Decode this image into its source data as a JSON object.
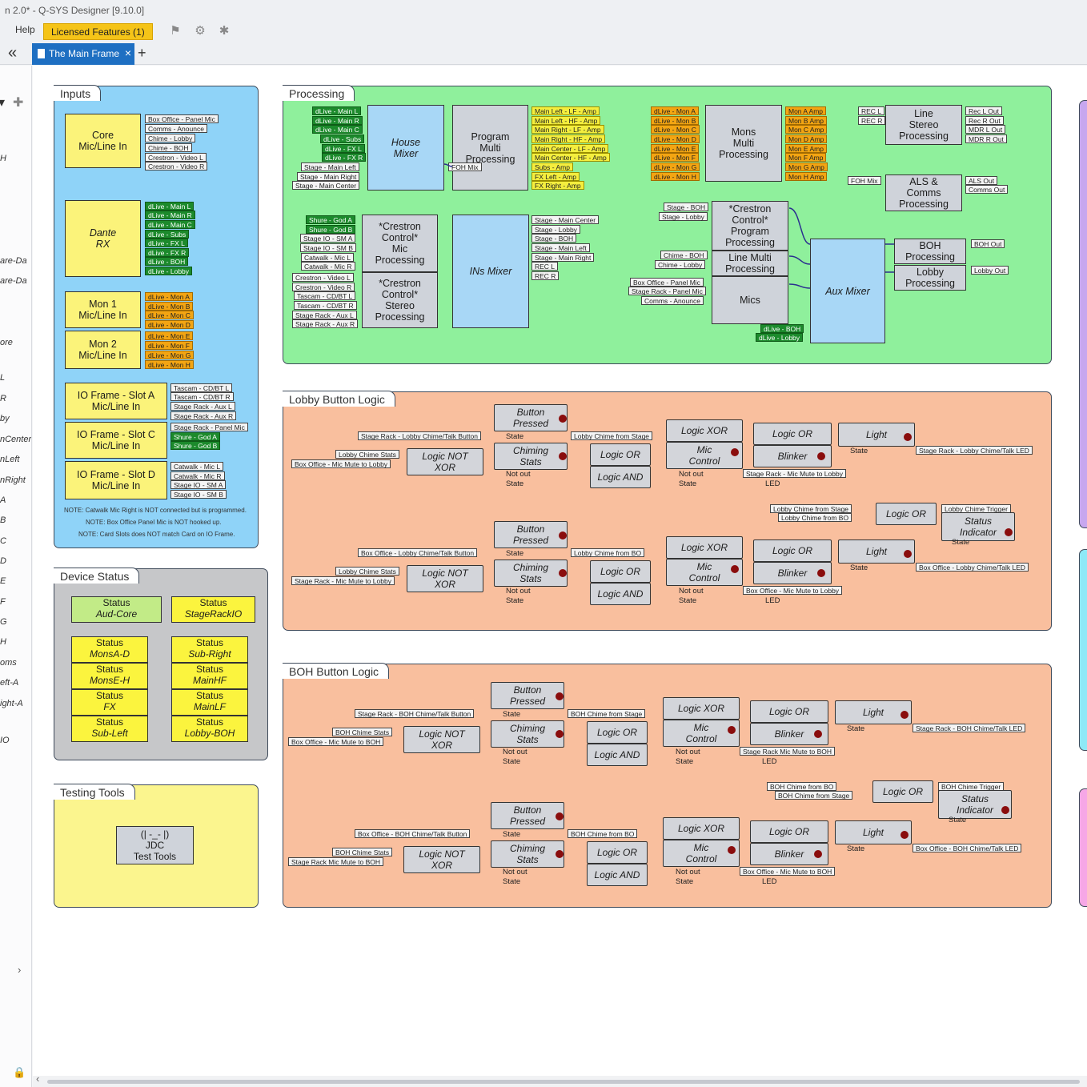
{
  "window": {
    "title": "n 2.0* - Q-SYS Designer [9.10.0]"
  },
  "menu": {
    "help": "Help",
    "licensed": "Licensed Features (1)"
  },
  "toolbar": {
    "icons": [
      "megaphone-icon",
      "gear-refresh-icon",
      "puzzle-icon"
    ]
  },
  "tabs": {
    "active": "The Main Frame",
    "add": "+"
  },
  "left_strip": {
    "items": [
      "are-Da",
      "are-Da",
      "ore",
      "L",
      "R",
      "by",
      "nCenter",
      "nLeft",
      "nRight",
      "A",
      "B",
      "C",
      "D",
      "E",
      "F",
      "G",
      "H",
      "oms",
      "eft-A",
      "ight-A",
      "IO"
    ]
  },
  "groups": {
    "inputs": "Inputs",
    "processing": "Processing",
    "lobby": "Lobby Button Logic",
    "device_status": "Device Status",
    "boh": "BOH Button Logic",
    "testing": "Testing Tools"
  },
  "inputs": {
    "core": {
      "label": "Core\nMic/Line In",
      "tags": [
        "Box Office - Panel Mic",
        "Comms - Anounce",
        "Chime - Lobby",
        "Chime - BOH",
        "Crestron - Video L",
        "Crestron - Video R"
      ]
    },
    "dante": {
      "label": "Dante\nRX",
      "tags": [
        "dLive - Main L",
        "dLive - Main R",
        "dLive - Main C",
        "dLive - Subs",
        "dLive - FX L",
        "dLive - FX R",
        "dLive - BOH",
        "dLive - Lobby"
      ]
    },
    "mon1": {
      "label": "Mon 1\nMic/Line In",
      "tags": [
        "dLive - Mon A",
        "dLive - Mon B",
        "dLive - Mon C",
        "dLive - Mon D"
      ]
    },
    "mon2": {
      "label": "Mon 2\nMic/Line In",
      "tags": [
        "dLive - Mon E",
        "dLive - Mon F",
        "dLive - Mon G",
        "dLive - Mon H"
      ]
    },
    "slotA": {
      "label": "IO Frame - Slot A\nMic/Line In",
      "tags": [
        "Tascam - CD/BT L",
        "Tascam - CD/BT R",
        "Stage Rack - Aux L",
        "Stage Rack - Aux R"
      ]
    },
    "slotC": {
      "label": "IO Frame - Slot C\nMic/Line In",
      "tags": [
        "Stage Rack - Panel Mic",
        "Shure - God A",
        "Shure - God B"
      ]
    },
    "slotD": {
      "label": "IO Frame - Slot D\nMic/Line In",
      "tags": [
        "Catwalk - Mic L",
        "Catwalk - Mic R",
        "Stage IO - SM A",
        "Stage IO - SM B"
      ]
    },
    "notes": [
      "NOTE: Catwalk Mic Right is NOT connected but is programmed.",
      "NOTE: Box Office Panel Mic is NOT hooked up.",
      "NOTE: Card Slots does NOT match Card on IO Frame."
    ]
  },
  "processing": {
    "house_mixer": {
      "label": "House\nMixer",
      "in_tags": [
        "dLive - Main L",
        "dLive - Main R",
        "dLive - Main C",
        "dLive - Subs",
        "dLive - FX L",
        "dLive - FX R",
        "Stage - Main Left",
        "Stage - Main Right",
        "Stage - Main Center"
      ]
    },
    "program_multi": {
      "label": "Program\nMulti\nProcessing",
      "in_tags": [
        "FOH Mix"
      ],
      "out_tags": [
        "Main Left - LF - Amp",
        "Main Left - HF - Amp",
        "Main Right - LF - Amp",
        "Main Right - HF - Amp",
        "Main Center - LF - Amp",
        "Main Center - HF - Amp",
        "Subs - Amp",
        "FX Left - Amp",
        "FX Right - Amp"
      ]
    },
    "mons_multi": {
      "label": "Mons\nMulti\nProcessing",
      "in_tags": [
        "dLive - Mon A",
        "dLive - Mon B",
        "dLive - Mon C",
        "dLive - Mon D",
        "dLive - Mon E",
        "dLive - Mon F",
        "dLive - Mon G",
        "dLive - Mon H"
      ],
      "out_tags": [
        "Mon A Amp",
        "Mon B Amp",
        "Mon C Amp",
        "Mon D Amp",
        "Mon E Amp",
        "Mon F Amp",
        "Mon G Amp",
        "Mon H Amp"
      ]
    },
    "line_stereo": {
      "label": "Line\nStereo\nProcessing",
      "in_tags": [
        "REC L",
        "REC R"
      ],
      "out_tags": [
        "Rec L Out",
        "Rec R Out",
        "MDR L Out",
        "MDR R Out"
      ]
    },
    "als_comms": {
      "label": "ALS &\nComms\nProcessing",
      "in_tags": [
        "FOH Mix"
      ],
      "out_tags": [
        "ALS Out",
        "Comms Out"
      ]
    },
    "crestron_mic": {
      "label": "*Crestron\nControl*\nMic\nProcessing",
      "in_tags": [
        "Shure - God A",
        "Shure - God B",
        "Stage IO - SM A",
        "Stage IO - SM B",
        "Catwalk - Mic L",
        "Catwalk - Mic R"
      ]
    },
    "crestron_stereo": {
      "label": "*Crestron\nControl*\nStereo\nProcessing",
      "in_tags": [
        "Crestron - Video L",
        "Crestron - Video R",
        "Tascam - CD/BT L",
        "Tascam - CD/BT R",
        "Stage Rack - Aux L",
        "Stage Rack - Aux R"
      ]
    },
    "ins_mixer": {
      "label": "INs Mixer",
      "out_tags": [
        "Stage - Main Center",
        "Stage - Lobby",
        "Stage - BOH",
        "Stage - Main Left",
        "Stage - Main Right",
        "REC L",
        "REC R"
      ]
    },
    "crestron_program": {
      "label": "*Crestron\nControl*\nProgram\nProcessing",
      "in_tags": [
        "Stage - BOH",
        "Stage - Lobby"
      ]
    },
    "line_multi": {
      "label": "Line Multi\nProcessing",
      "in_tags": [
        "Chime - BOH",
        "Chime - Lobby"
      ]
    },
    "mics": {
      "label": "Mics",
      "in_tags": [
        "Box Office - Panel Mic",
        "Stage Rack - Panel Mic",
        "Comms - Anounce"
      ]
    },
    "aux_mixer": {
      "label": "Aux Mixer",
      "in_tags": [
        "dLive - BOH",
        "dLive - Lobby"
      ]
    },
    "boh_proc": {
      "label": "BOH\nProcessing",
      "out_tags": [
        "BOH Out"
      ]
    },
    "lobby_proc": {
      "label": "Lobby\nProcessing",
      "out_tags": [
        "Lobby Out"
      ]
    }
  },
  "lobby_logic": {
    "row1": {
      "button_pressed": "Button\nPressed",
      "chiming_stats": "Chiming\nStats",
      "not_out": "Not out",
      "state": "State",
      "logic_not_xor": "Logic NOT\nXOR",
      "logic_or_a": "Logic OR",
      "logic_and": "Logic AND",
      "logic_xor": "Logic XOR",
      "mic_control": "Mic\nControl",
      "logic_or_b": "Logic OR",
      "blinker": "Blinker",
      "led": "LED",
      "light": "Light",
      "tags": [
        "Stage Rack - Lobby Chime/Talk Button",
        "Lobby Chime Stats",
        "Box Office - Mic Mute to Lobby",
        "Lobby Chime from Stage",
        "Stage Rack - Mic Mute to Lobby",
        "Stage Rack - Lobby Chime/Talk LED"
      ]
    },
    "trigger": {
      "logic_or": "Logic OR",
      "status": "Status\nIndicator",
      "state": "State",
      "tags": [
        "Lobby Chime from Stage",
        "Lobby Chime from BO",
        "Lobby Chime Trigger"
      ]
    },
    "row2": {
      "button_pressed": "Button\nPressed",
      "chiming_stats": "Chiming\nStats",
      "not_out": "Not out",
      "state": "State",
      "logic_not_xor": "Logic NOT\nXOR",
      "logic_or_a": "Logic OR",
      "logic_and": "Logic AND",
      "logic_xor": "Logic XOR",
      "mic_control": "Mic\nControl",
      "logic_or_b": "Logic OR",
      "blinker": "Blinker",
      "led": "LED",
      "light": "Light",
      "tags": [
        "Box Office - Lobby Chime/Talk Button",
        "Lobby Chime Stats",
        "Stage Rack - Mic Mute to Lobby",
        "Lobby Chime from BO",
        "Box Office - Mic Mute to Lobby",
        "Box Office - Lobby Chime/Talk LED"
      ]
    }
  },
  "boh_logic": {
    "row1": {
      "button_pressed": "Button\nPressed",
      "chiming_stats": "Chiming\nStats",
      "not_out": "Not out",
      "state": "State",
      "logic_not_xor": "Logic NOT\nXOR",
      "logic_or_a": "Logic OR",
      "logic_and": "Logic AND",
      "logic_xor": "Logic XOR",
      "mic_control": "Mic\nControl",
      "logic_or_b": "Logic OR",
      "blinker": "Blinker",
      "led": "LED",
      "light": "Light",
      "tags": [
        "Stage Rack - BOH Chime/Talk Button",
        "BOH Chime Stats",
        "Box Office - Mic Mute to BOH",
        "BOH Chime from Stage",
        "Stage Rack Mic Mute to BOH",
        "Stage Rack - BOH Chime/Talk LED"
      ]
    },
    "trigger": {
      "logic_or": "Logic OR",
      "status": "Status\nIndicator",
      "state": "State",
      "tags": [
        "BOH Chime from BO",
        "BOH Chime from Stage",
        "BOH Chime Trigger"
      ]
    },
    "row2": {
      "button_pressed": "Button\nPressed",
      "chiming_stats": "Chiming\nStats",
      "not_out": "Not out",
      "state": "State",
      "logic_not_xor": "Logic NOT\nXOR",
      "logic_or_a": "Logic OR",
      "logic_and": "Logic AND",
      "logic_xor": "Logic XOR",
      "mic_control": "Mic\nControl",
      "logic_or_b": "Logic OR",
      "blinker": "Blinker",
      "led": "LED",
      "light": "Light",
      "tags": [
        "Box Office - BOH Chime/Talk Button",
        "BOH Chime Stats",
        "Stage Rack Mic Mute to BOH",
        "BOH Chime from BO",
        "Box Office - Mic Mute to BOH",
        "Box Office - BOH Chime/Talk LED"
      ]
    }
  },
  "device_status": {
    "items": [
      {
        "line1": "Status",
        "line2": "Aud-Core"
      },
      {
        "line1": "Status",
        "line2": "StageRackIO"
      },
      {
        "line1": "Status",
        "line2": "MonsA-D"
      },
      {
        "line1": "Status",
        "line2": "Sub-Right"
      },
      {
        "line1": "Status",
        "line2": "MonsE-H"
      },
      {
        "line1": "Status",
        "line2": "MainHF"
      },
      {
        "line1": "Status",
        "line2": "FX"
      },
      {
        "line1": "Status",
        "line2": "MainLF"
      },
      {
        "line1": "Status",
        "line2": "Sub-Left"
      },
      {
        "line1": "Status",
        "line2": "Lobby-BOH"
      }
    ]
  },
  "testing_tools": {
    "label": "(| -_- |)\nJDC\nTest Tools"
  },
  "colors": {
    "inputs_bg": "#8fd3f8",
    "processing_bg": "#8ff09c",
    "logic_bg": "#f9bf9e",
    "status_bg": "#c6c7c9",
    "testing_bg": "#fbf58e",
    "accent": "#1e6fc2",
    "licensed": "#f5c418"
  }
}
